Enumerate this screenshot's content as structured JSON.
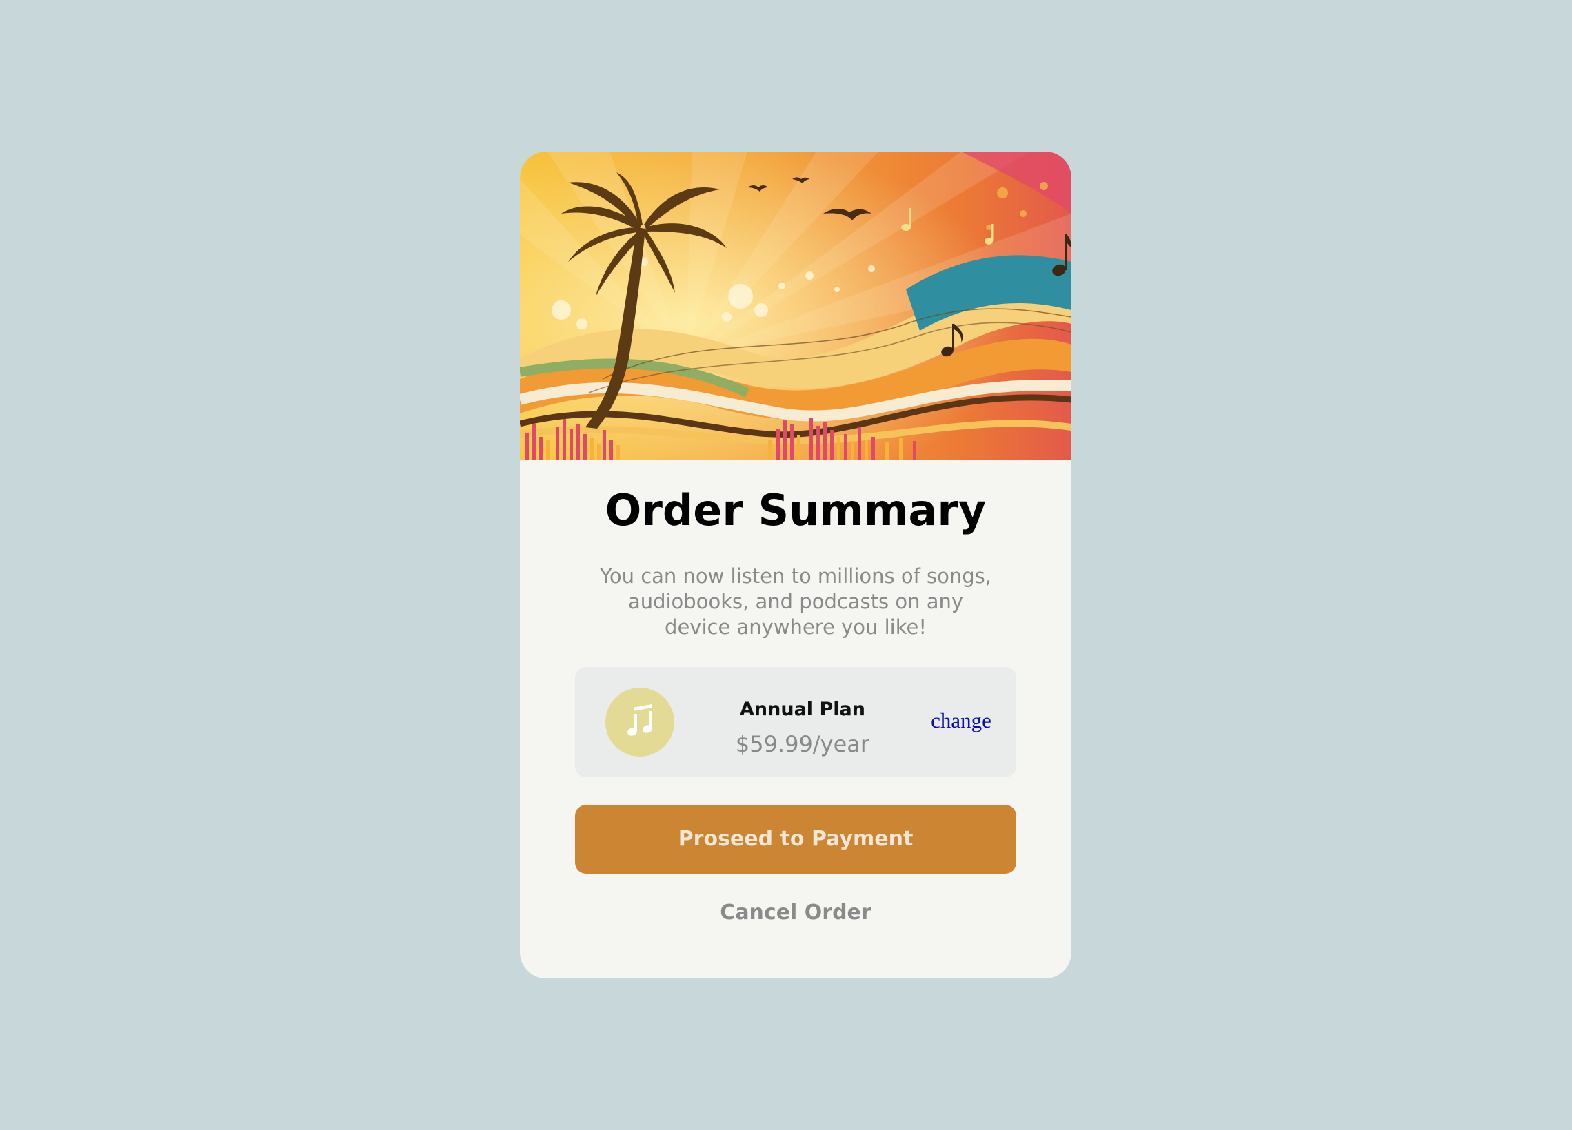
{
  "card": {
    "title": "Order Summary",
    "description": "You can now listen to millions of songs, audiobooks, and podcasts on any device anywhere you like!",
    "hero_image": "tropical-music-sunset-illustration"
  },
  "plan": {
    "icon": "music-note-icon",
    "name": "Annual Plan",
    "price": "$59.99/year",
    "change_label": "change"
  },
  "actions": {
    "proceed_label": "Proseed to Payment",
    "cancel_label": "Cancel Order"
  },
  "colors": {
    "background": "#c8d7d9",
    "card": "#f5f6f1",
    "plan_box": "#e9ecea",
    "icon_circle": "#e3db95",
    "button": "#cc8533",
    "link": "#0f0fb0",
    "muted_text": "#898989"
  }
}
